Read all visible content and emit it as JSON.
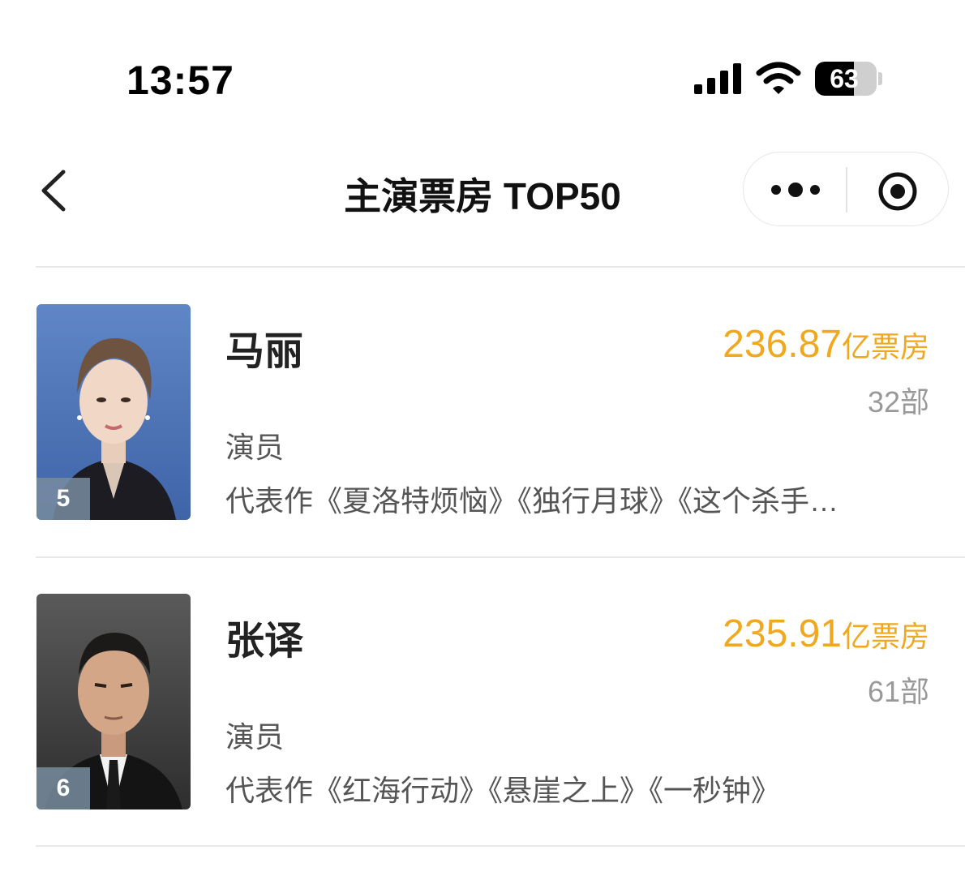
{
  "status_bar": {
    "time": "13:57",
    "battery_level": "63",
    "battery_fraction": 0.63
  },
  "nav": {
    "back_icon": "chevron-left-icon",
    "title": "主演票房 TOP50",
    "more_icon": "more-dots-icon",
    "close_icon": "target-circle-icon"
  },
  "colors": {
    "accent_box_office": "#f0a81e",
    "divider": "#e8e8e8",
    "badge": "#788ca0"
  },
  "list": [
    {
      "rank": "5",
      "name": "马丽",
      "role": "演员",
      "box_office": "236.87",
      "box_office_unit": "亿票房",
      "film_count": "32部",
      "works": "代表作《夏洛特烦恼》《独行月球》《这个杀手…"
    },
    {
      "rank": "6",
      "name": "张译",
      "role": "演员",
      "box_office": "235.91",
      "box_office_unit": "亿票房",
      "film_count": "61部",
      "works": "代表作《红海行动》《悬崖之上》《一秒钟》"
    }
  ]
}
